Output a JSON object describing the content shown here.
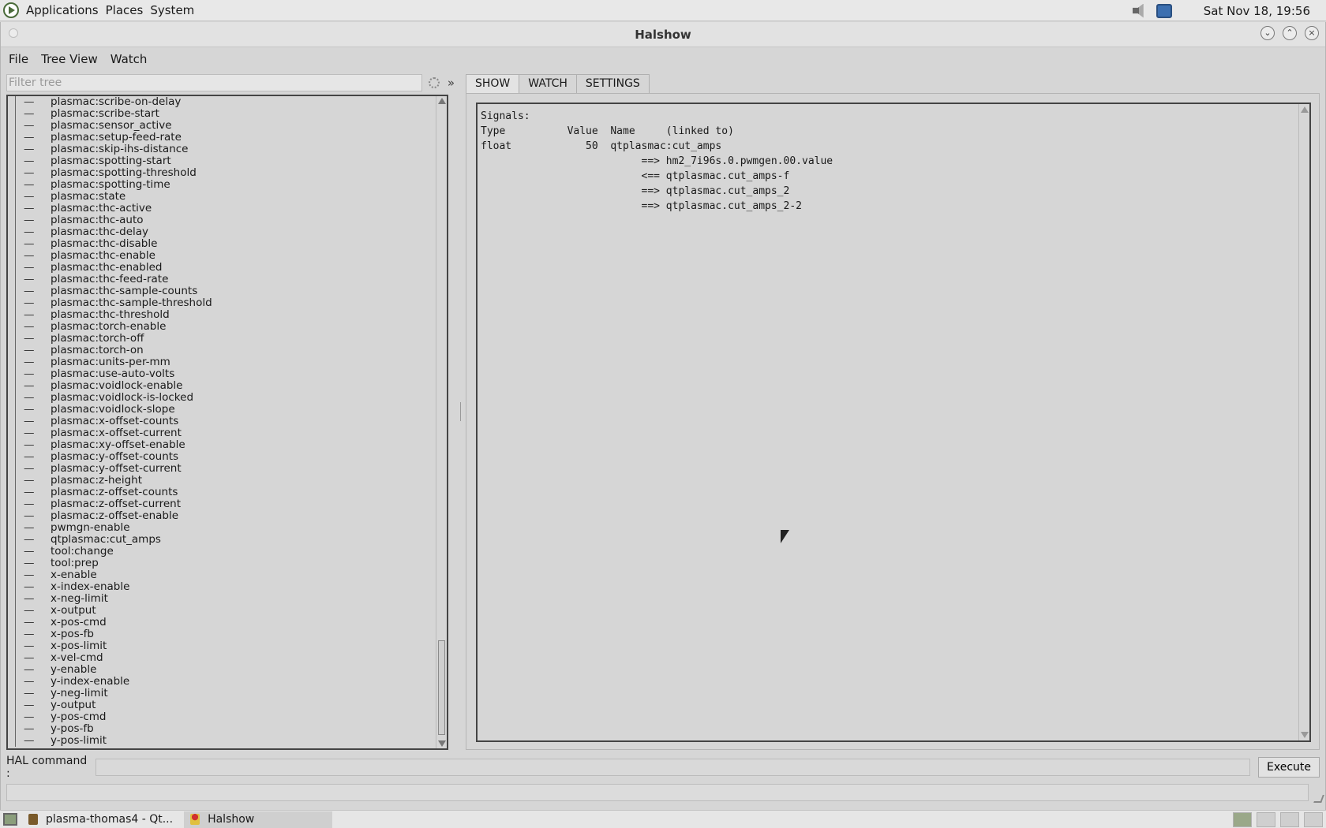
{
  "top_panel": {
    "menus": [
      "Applications",
      "Places",
      "System"
    ],
    "clock": "Sat Nov 18, 19:56"
  },
  "window": {
    "title": "Halshow",
    "controls": {
      "minimize": "⌄",
      "maximize": "⌃",
      "close": "×"
    }
  },
  "menubar": {
    "file": "File",
    "tree_view": "Tree View",
    "watch": "Watch"
  },
  "filter": {
    "placeholder": "Filter tree",
    "more": "»"
  },
  "tree": {
    "items": [
      "plasmac:scribe-on-delay",
      "plasmac:scribe-start",
      "plasmac:sensor_active",
      "plasmac:setup-feed-rate",
      "plasmac:skip-ihs-distance",
      "plasmac:spotting-start",
      "plasmac:spotting-threshold",
      "plasmac:spotting-time",
      "plasmac:state",
      "plasmac:thc-active",
      "plasmac:thc-auto",
      "plasmac:thc-delay",
      "plasmac:thc-disable",
      "plasmac:thc-enable",
      "plasmac:thc-enabled",
      "plasmac:thc-feed-rate",
      "plasmac:thc-sample-counts",
      "plasmac:thc-sample-threshold",
      "plasmac:thc-threshold",
      "plasmac:torch-enable",
      "plasmac:torch-off",
      "plasmac:torch-on",
      "plasmac:units-per-mm",
      "plasmac:use-auto-volts",
      "plasmac:voidlock-enable",
      "plasmac:voidlock-is-locked",
      "plasmac:voidlock-slope",
      "plasmac:x-offset-counts",
      "plasmac:x-offset-current",
      "plasmac:xy-offset-enable",
      "plasmac:y-offset-counts",
      "plasmac:y-offset-current",
      "plasmac:z-height",
      "plasmac:z-offset-counts",
      "plasmac:z-offset-current",
      "plasmac:z-offset-enable",
      "pwmgn-enable",
      "qtplasmac:cut_amps",
      "tool:change",
      "tool:prep",
      "x-enable",
      "x-index-enable",
      "x-neg-limit",
      "x-output",
      "x-pos-cmd",
      "x-pos-fb",
      "x-pos-limit",
      "x-vel-cmd",
      "y-enable",
      "y-index-enable",
      "y-neg-limit",
      "y-output",
      "y-pos-cmd",
      "y-pos-fb",
      "y-pos-limit"
    ]
  },
  "tabs": {
    "show": "SHOW",
    "watch": "WATCH",
    "settings": "SETTINGS"
  },
  "show": {
    "lines": [
      "Signals:",
      "Type          Value  Name     (linked to)",
      "float            50  qtplasmac:cut_amps",
      "                          ==> hm2_7i96s.0.pwmgen.00.value",
      "                          <== qtplasmac.cut_amps-f",
      "                          ==> qtplasmac.cut_amps_2",
      "                          ==> qtplasmac.cut_amps_2-2"
    ]
  },
  "command": {
    "label": "HAL command :",
    "execute": "Execute"
  },
  "taskbar": {
    "tasks": [
      "plasma-thomas4 - Qt...",
      "Halshow"
    ]
  }
}
